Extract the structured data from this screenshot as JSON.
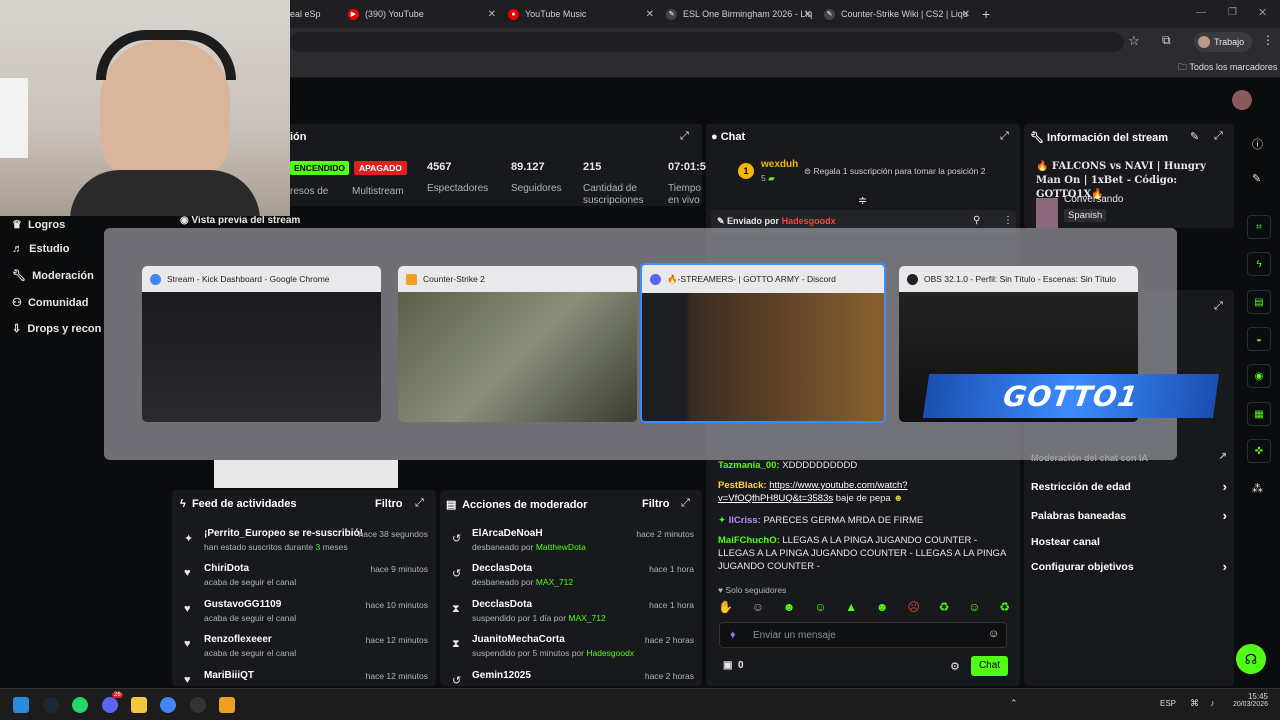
{
  "browser": {
    "tabs": [
      {
        "label": "eal eSp",
        "icon": "esport-icon"
      },
      {
        "label": "(390) YouTube",
        "icon": "youtube-icon"
      },
      {
        "label": "YouTube Music",
        "icon": "youtube-music-icon"
      },
      {
        "label": "ESL One Birmingham 2026 - Liq",
        "icon": "liquipedia-icon"
      },
      {
        "label": "Counter-Strike Wiki | CS2 | Liqu",
        "icon": "liquipedia-icon"
      }
    ],
    "profile": "Trabajo",
    "bookmarks_all": "Todos los marcadores"
  },
  "dashboard": {
    "stats_title_partial": "ión",
    "live_badge": "ENCENDIDO",
    "off_badge": "APAGADO",
    "multistream_label": "Multistream",
    "ingresos_partial": "resos de",
    "stats": [
      {
        "value": "4567",
        "label": "Espectadores"
      },
      {
        "value": "89.127",
        "label": "Seguidores"
      },
      {
        "value": "215",
        "label": "Cantidad de suscripciones"
      },
      {
        "value": "07:01:5",
        "label": "Tiempo en vivo"
      }
    ],
    "preview_title": "Vista previa del stream",
    "sidebar": [
      "Logros",
      "Estudio",
      "Moderación",
      "Comunidad",
      "Drops y recon"
    ]
  },
  "chat": {
    "title": "Chat",
    "top_user": "wexduh",
    "top_rank": "1",
    "top_count": "5",
    "gift_prompt": "Regala 1 suscripción para tomar la posición 2",
    "pinned_by_label": "Enviado por",
    "pinned_by_user": "Hadesgoodx",
    "messages": [
      {
        "user": "Tazmania_00:",
        "text": " XDDDDDDDDDD",
        "color": "#53fc18"
      },
      {
        "user": "PestBlack:",
        "text": " baje de pepa",
        "link": "https://www.youtube.com/watch?v=VfOQfhPH8UQ&t=3583s",
        "color": "#ffd23f"
      },
      {
        "user": "IlCriss:",
        "text": " PARECES GERMA MRDA DE FIRME",
        "color": "#b48cff"
      },
      {
        "user": "MaiFChuchO:",
        "text": " LLEGAS A LA PINGA JUGANDO COUNTER - LLEGAS A LA PINGA JUGANDO COUNTER - LLEGAS A LA PINGA JUGANDO COUNTER -",
        "color": "#53fc18"
      }
    ],
    "followers_only": "Solo seguidores",
    "input_placeholder": "Enviar un mensaje",
    "points": "0",
    "send_label": "Chat"
  },
  "stream_info": {
    "title": "Información del stream",
    "stream_title": "🔥 FALCONS vs NAVI | Hungry Man On | 1xBet - Código: GOTTO1X🔥",
    "category": "Conversando",
    "language": "Spanish"
  },
  "settings": {
    "items": [
      {
        "label": "Moderación del chat con IA"
      },
      {
        "label": "Restricción de edad",
        "chevron": true
      },
      {
        "label": "Palabras baneadas",
        "chevron": true
      },
      {
        "label": "Hostear canal",
        "chevron": false
      },
      {
        "label": "Configurar objetivos",
        "chevron": true
      }
    ]
  },
  "activity_feed": {
    "title": "Feed de actividades",
    "filter": "Filtro",
    "rows": [
      {
        "name": "¡Perrito_Europeo se re-suscribió!",
        "sub": "han estado suscritos durante ",
        "sub_green": "3",
        "sub_after": " meses",
        "time": "hace 38 segundos",
        "icon": "sparkle-icon"
      },
      {
        "name": "ChiriDota",
        "sub": "acaba de seguir el canal",
        "time": "hace 9 minutos",
        "icon": "heart-icon"
      },
      {
        "name": "GustavoGG1109",
        "sub": "acaba de seguir el canal",
        "time": "hace 10 minutos",
        "icon": "heart-icon"
      },
      {
        "name": "Renzoflexeeer",
        "sub": "acaba de seguir el canal",
        "time": "hace 12 minutos",
        "icon": "heart-icon"
      },
      {
        "name": "MariBiiiQT",
        "sub": "",
        "time": "hace 12 minutos",
        "icon": "heart-icon"
      }
    ]
  },
  "mod_actions": {
    "title": "Acciones de moderador",
    "filter": "Filtro",
    "rows": [
      {
        "name": "ElArcaDeNoaH",
        "sub": "desbaneado por ",
        "by": "MatthewDota",
        "time": "hace 2 minutos",
        "icon": "undo-icon"
      },
      {
        "name": "DecclasDota",
        "sub": "desbaneado por ",
        "by": "MAX_712",
        "time": "hace 1 hora",
        "icon": "undo-icon"
      },
      {
        "name": "DecclasDota",
        "sub": "suspendido por 1 día por ",
        "by": "MAX_712",
        "time": "hace 1 hora",
        "icon": "hourglass-icon"
      },
      {
        "name": "JuanitoMechaCorta",
        "sub": "suspendido por 5 minutos por ",
        "by": "Hadesgoodx",
        "time": "hace 2 horas",
        "icon": "hourglass-icon"
      },
      {
        "name": "Gemin12025",
        "sub": "",
        "by": "",
        "time": "hace 2 horas",
        "icon": "undo-icon"
      }
    ]
  },
  "switcher": {
    "windows": [
      {
        "title": "Stream - Kick Dashboard - Google Chrome",
        "icon": "chrome-icon",
        "icon_color": "#4285f4"
      },
      {
        "title": "Counter-Strike 2",
        "icon": "cs2-icon",
        "icon_color": "#f0a020"
      },
      {
        "title": "🔥-STREAMERS- | GOTTO ARMY - Discord",
        "icon": "discord-icon",
        "icon_color": "#5865f2"
      },
      {
        "title": "OBS 32.1.0 - Perfil: Sin Título - Escenas: Sin Título",
        "icon": "obs-icon",
        "icon_color": "#222"
      }
    ],
    "overlay_logo": "GOTTO1"
  },
  "taskbar": {
    "lang": "ESP",
    "time": "15:45",
    "date": "20/03/2026",
    "discord_badge": "26"
  }
}
